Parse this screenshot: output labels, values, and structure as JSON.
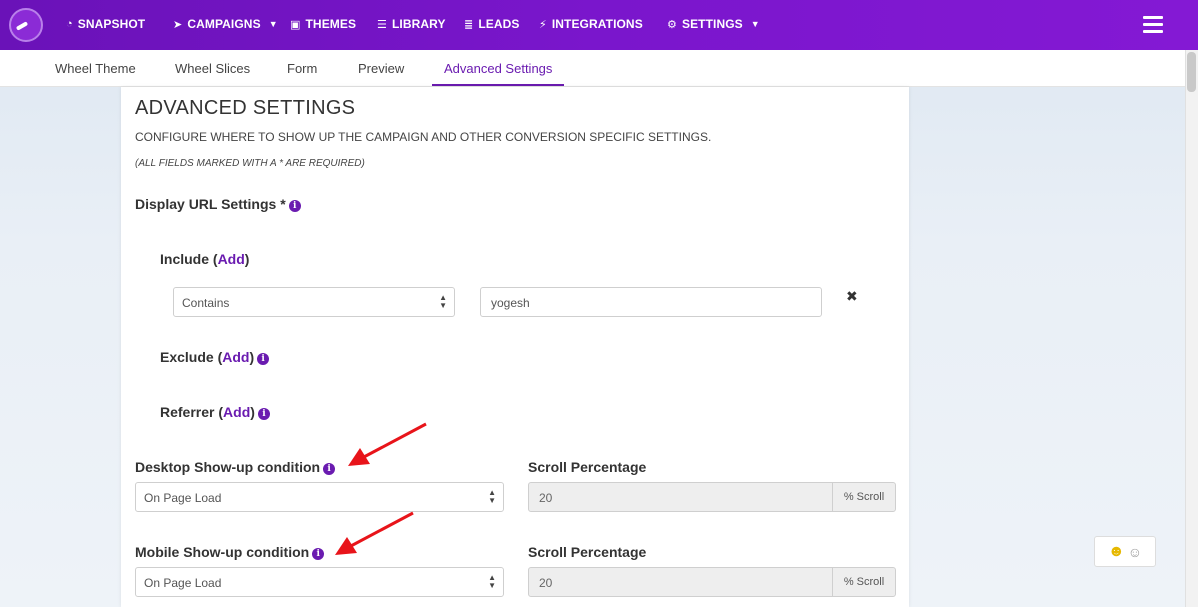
{
  "nav": {
    "items": [
      {
        "label": "SNAPSHOT",
        "icon": "dashboard-icon"
      },
      {
        "label": "CAMPAIGNS",
        "icon": "paper-plane-icon",
        "dropdown": true
      },
      {
        "label": "THEMES",
        "icon": "image-icon"
      },
      {
        "label": "LIBRARY",
        "icon": "library-icon"
      },
      {
        "label": "LEADS",
        "icon": "list-icon"
      },
      {
        "label": "INTEGRATIONS",
        "icon": "plug-icon"
      },
      {
        "label": "SETTINGS",
        "icon": "gears-icon",
        "dropdown": true
      }
    ]
  },
  "tabs": {
    "items": [
      "Wheel Theme",
      "Wheel Slices",
      "Form",
      "Preview",
      "Advanced Settings"
    ],
    "active": "Advanced Settings"
  },
  "page": {
    "title": "ADVANCED SETTINGS",
    "description": "CONFIGURE WHERE TO SHOW UP THE CAMPAIGN AND OTHER CONVERSION SPECIFIC SETTINGS.",
    "required_note": "(ALL FIELDS MARKED WITH A * ARE REQUIRED)"
  },
  "display_url": {
    "label": "Display URL Settings *",
    "include_label": "Include (",
    "include_link": "Add",
    "include_close": ")",
    "include_rule": {
      "operator": "Contains",
      "value": "yogesh"
    },
    "remove_glyph": "✖",
    "exclude_label": "Exclude (",
    "exclude_link": "Add",
    "exclude_close": ")",
    "referrer_label": "Referrer (",
    "referrer_link": "Add",
    "referrer_close": ")"
  },
  "desktop": {
    "label": "Desktop Show-up condition",
    "condition": "On Page Load",
    "scroll_label": "Scroll Percentage",
    "scroll_value": "20",
    "scroll_addon": "% Scroll"
  },
  "mobile": {
    "label": "Mobile Show-up condition",
    "condition": "On Page Load",
    "scroll_label": "Scroll Percentage",
    "scroll_value": "20",
    "scroll_addon": "% Scroll"
  },
  "colors": {
    "nav_bg": "#7415c6",
    "accent": "#6a1bb0",
    "annotation_arrow": "#e8141a"
  }
}
